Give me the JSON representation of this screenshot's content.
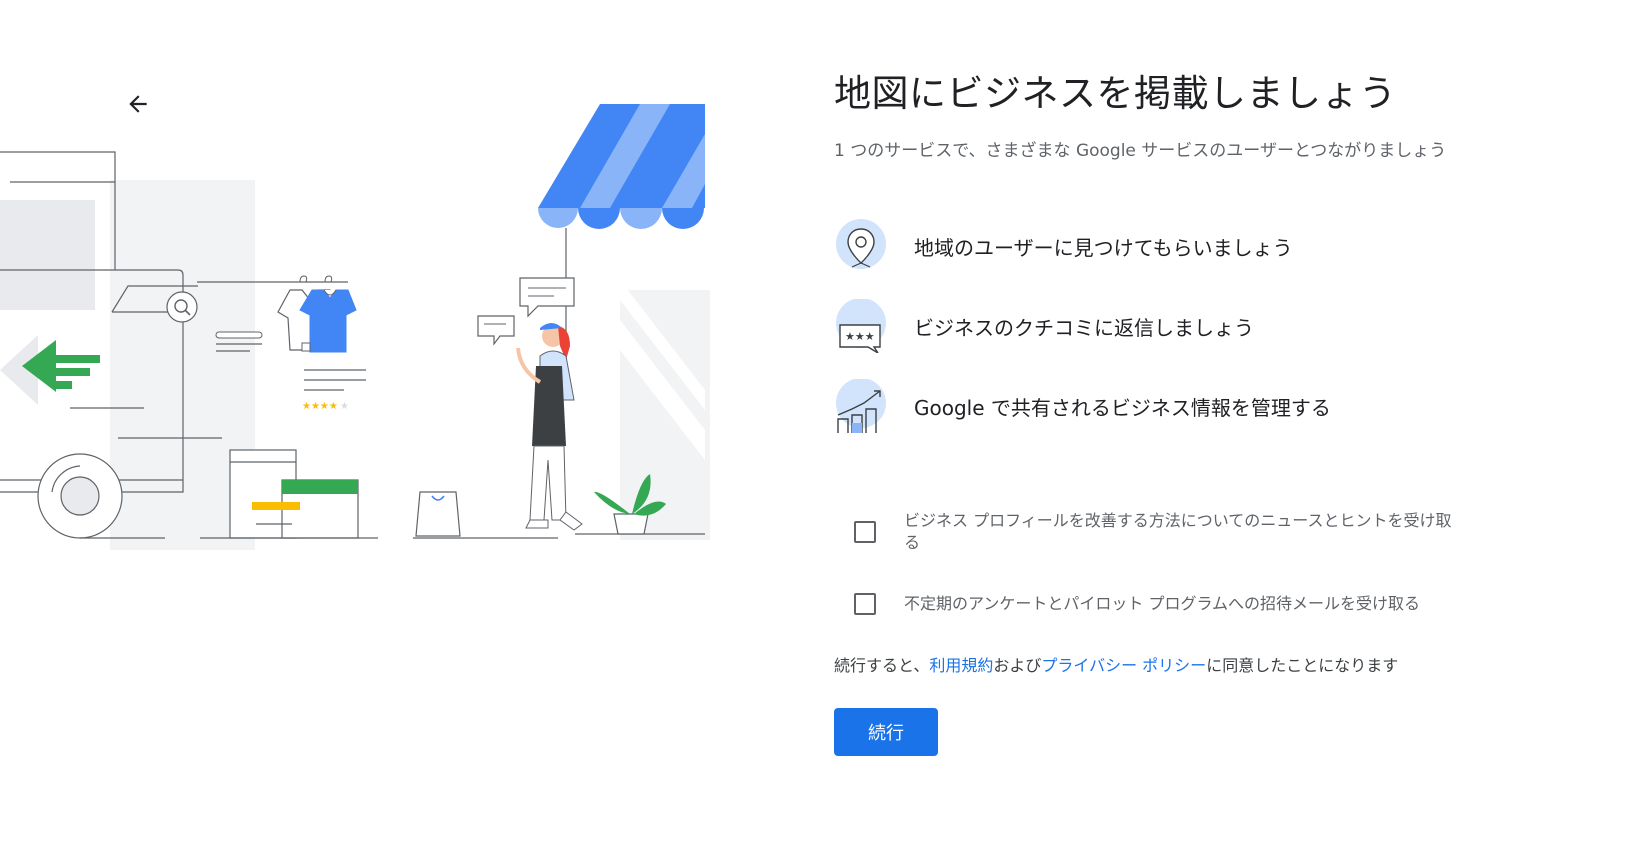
{
  "header": {
    "back_icon": "arrow-back-icon"
  },
  "main": {
    "title": "地図にビジネスを掲載しましょう",
    "subtitle": "1 つのサービスで、さまざまな Google サービスのユーザーとつながりましょう",
    "features": [
      {
        "icon": "location-pin-icon",
        "label": "地域のユーザーに見つけてもらいましょう"
      },
      {
        "icon": "review-bubble-icon",
        "label": "ビジネスのクチコミに返信しましょう"
      },
      {
        "icon": "chart-trend-icon",
        "label": "Google で共有されるビジネス情報を管理する"
      }
    ],
    "checkboxes": [
      {
        "label": "ビジネス プロフィールを改善する方法についてのニュースとヒントを受け取る",
        "checked": false
      },
      {
        "label": "不定期のアンケートとパイロット プログラムへの招待メールを受け取る",
        "checked": false
      }
    ],
    "terms": {
      "prefix": "続行すると、",
      "terms_link": "利用規約",
      "middle": "および",
      "privacy_link": "プライバシー ポリシー",
      "suffix": "に同意したことになります"
    },
    "continue_label": "続行"
  },
  "colors": {
    "primary": "#1a73e8",
    "awning_blue": "#4285f4",
    "awning_light": "#8ab4f8",
    "green": "#34a853",
    "yellow": "#fbbc04",
    "red": "#ea4335"
  }
}
